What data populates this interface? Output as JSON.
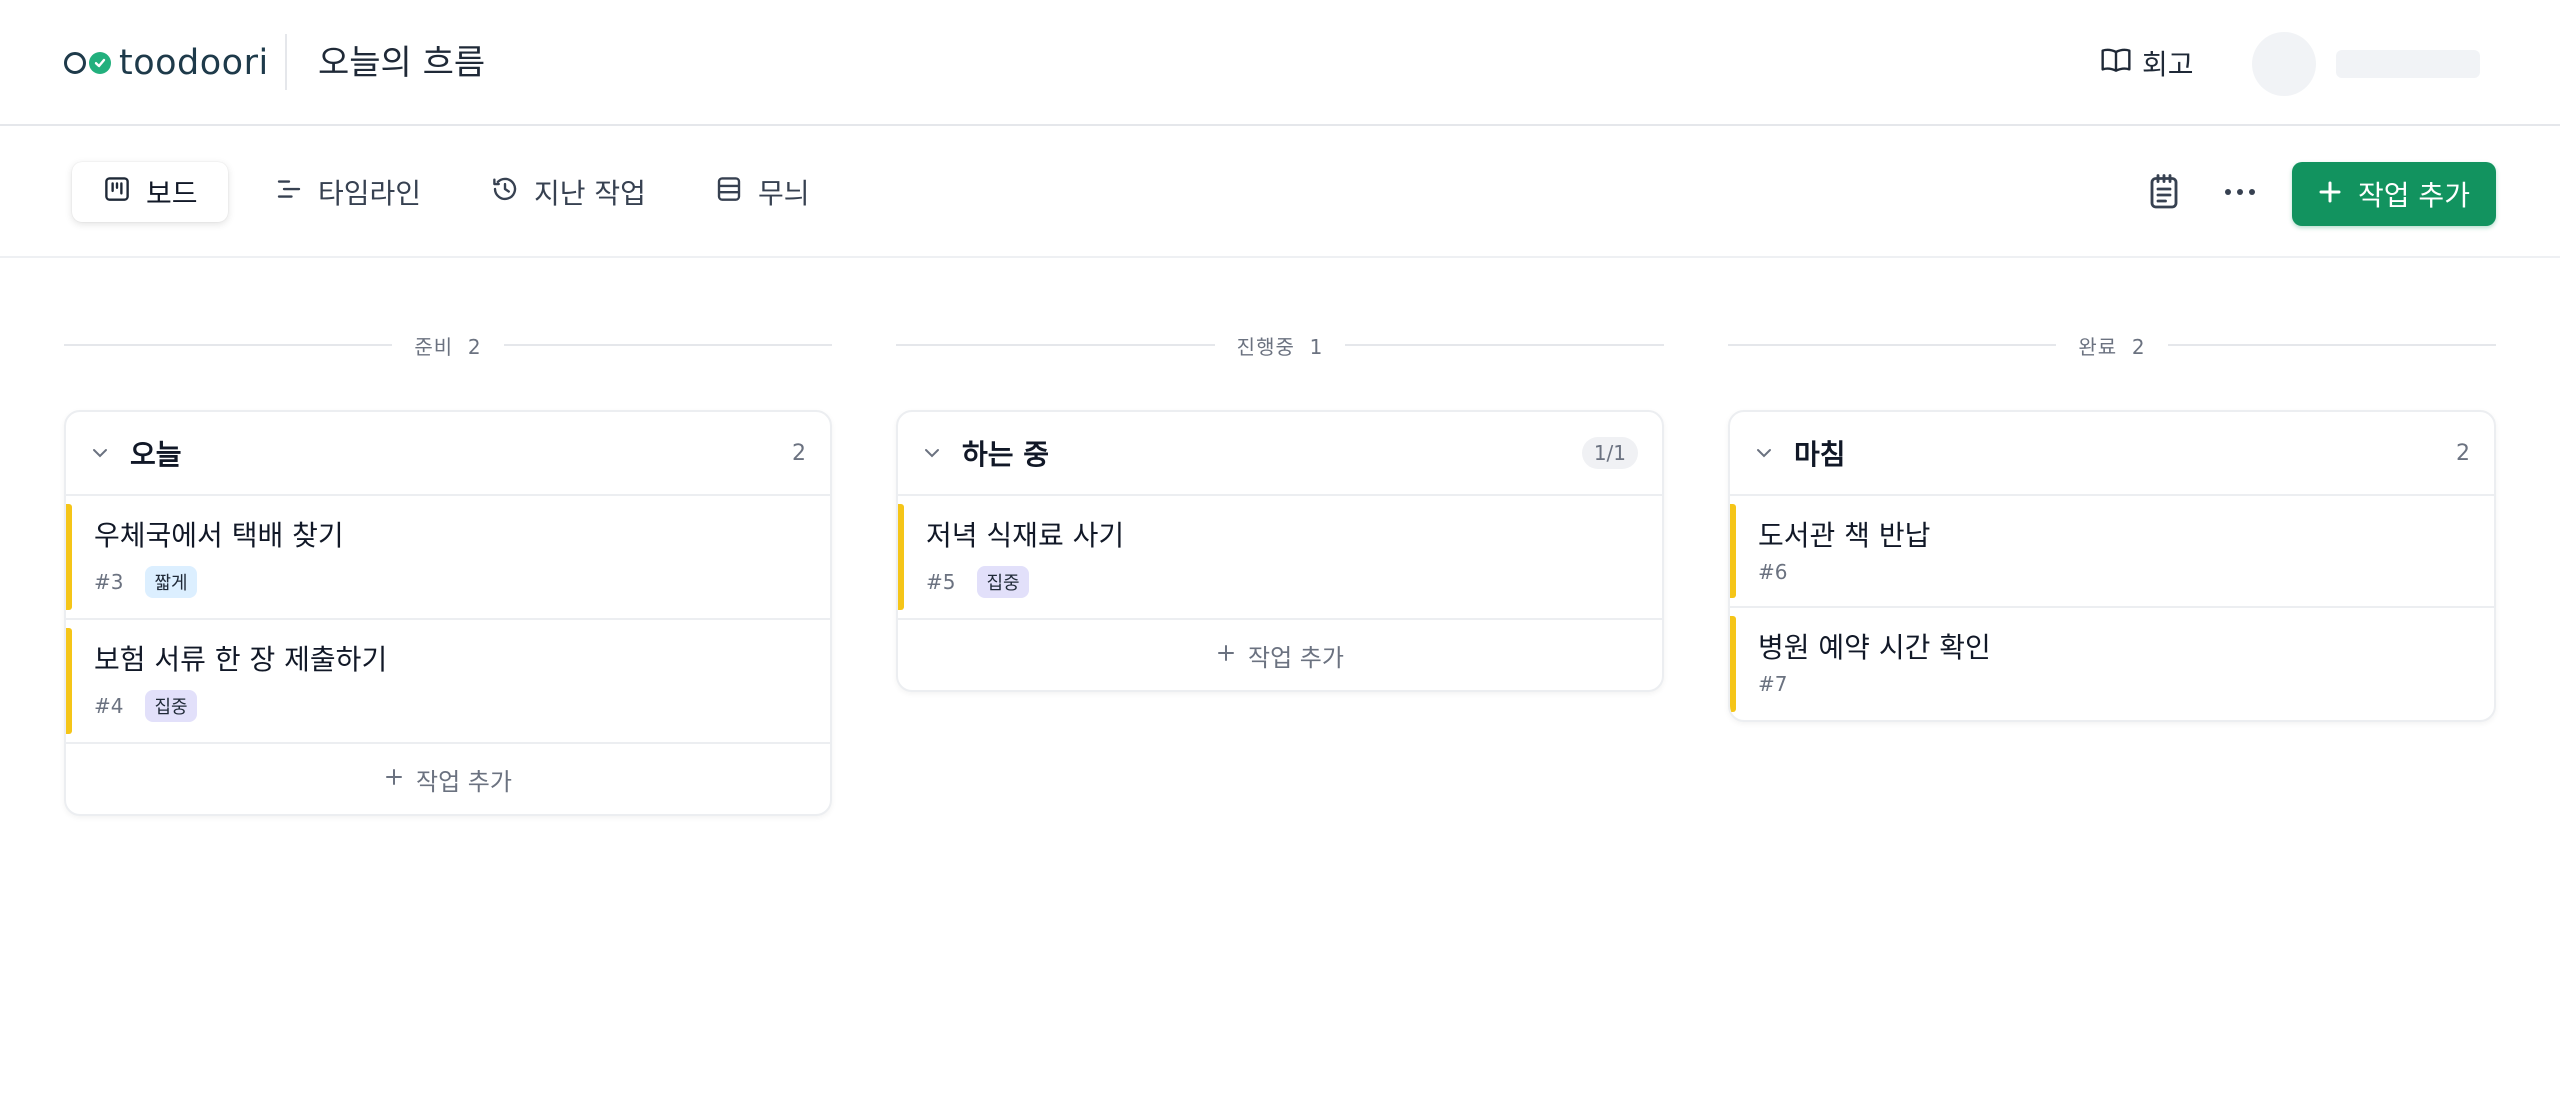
{
  "header": {
    "brand_name": "toodoori",
    "page_title": "오늘의 흐름",
    "review_label": "회고"
  },
  "toolbar": {
    "tabs": [
      {
        "label": "보드",
        "icon": "board-icon"
      },
      {
        "label": "타임라인",
        "icon": "timeline-icon"
      },
      {
        "label": "지난 작업",
        "icon": "history-icon"
      },
      {
        "label": "무늬",
        "icon": "layout-icon"
      }
    ],
    "add_label": "작업 추가"
  },
  "columns": [
    {
      "status": "준비",
      "status_count": "2",
      "group_title": "오늘",
      "group_count": "2",
      "tasks": [
        {
          "title": "우체국에서 택배 찾기",
          "num": "#3",
          "tag": "짧게"
        },
        {
          "title": "보험 서류 한 장 제출하기",
          "num": "#4",
          "tag": "집중"
        }
      ],
      "add_label": "작업 추가"
    },
    {
      "status": "진행중",
      "status_count": "1",
      "group_title": "하는 중",
      "group_count": "1/1",
      "tasks": [
        {
          "title": "저녁 식재료 사기",
          "num": "#5",
          "tag": "집중"
        }
      ],
      "add_label": "작업 추가"
    },
    {
      "status": "완료",
      "status_count": "2",
      "group_title": "마침",
      "group_count": "2",
      "tasks": [
        {
          "title": "도서관 책 반납",
          "num": "#6"
        },
        {
          "title": "병원 예약 시간 확인",
          "num": "#7"
        }
      ]
    }
  ],
  "colors": {
    "accent": "#12935f",
    "task_bar": "#f5c518",
    "tag_short": "#dcefff",
    "tag_focus": "#e2e0fa"
  }
}
